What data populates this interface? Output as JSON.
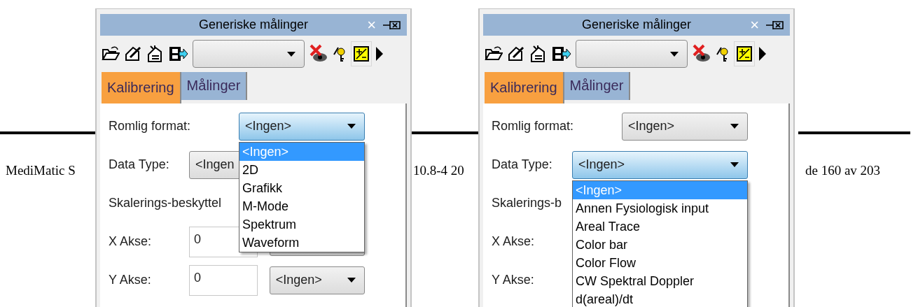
{
  "document": {
    "footer": [
      {
        "kind": "left",
        "text": "MediMatic S"
      },
      {
        "kind": "middle",
        "text": "10.8-4 20"
      },
      {
        "kind": "right",
        "text": "de 160 av 203"
      }
    ]
  },
  "panels": [
    {
      "title": "Generiske målinger",
      "close": "×",
      "tabs": [
        {
          "label": "Kalibrering",
          "selected": true
        },
        {
          "label": "Målinger",
          "selected": false
        }
      ],
      "rows": [
        {
          "kind": "select",
          "label": "Romlig format:",
          "value": "<Ingen>",
          "focused": true,
          "options": [
            {
              "label": "<Ingen>",
              "selected": true
            },
            {
              "label": "2D",
              "selected": false
            },
            {
              "label": "Grafikk",
              "selected": false
            },
            {
              "label": "M-Mode",
              "selected": false
            },
            {
              "label": "Spektrum",
              "selected": false
            },
            {
              "label": "Waveform",
              "selected": false
            }
          ]
        },
        {
          "kind": "wide_select",
          "label": "Data Type:",
          "value": "<Ingen",
          "focused": false
        },
        {
          "kind": "text",
          "label": "Skalerings-beskyttel"
        },
        {
          "kind": "input_select",
          "label": "X Akse:",
          "input": "0"
        },
        {
          "kind": "input_select",
          "label": "Y Akse:",
          "input": "0",
          "value": "<Ingen>"
        }
      ]
    },
    {
      "title": "Generiske målinger",
      "close": "×",
      "tabs": [
        {
          "label": "Kalibrering",
          "selected": true
        },
        {
          "label": "Målinger",
          "selected": false
        }
      ],
      "rows": [
        {
          "kind": "select",
          "label": "Romlig format:",
          "value": "<Ingen>",
          "focused": false
        },
        {
          "kind": "wide_select",
          "label": "Data Type:",
          "value": "<Ingen>",
          "focused": true,
          "options": [
            {
              "label": "<Ingen>",
              "selected": true
            },
            {
              "label": "Annen Fysiologisk input",
              "selected": false
            },
            {
              "label": "Areal Trace",
              "selected": false
            },
            {
              "label": "Color bar",
              "selected": false
            },
            {
              "label": "Color Flow",
              "selected": false
            },
            {
              "label": "CW Spektral Doppler",
              "selected": false
            },
            {
              "label": "d(areal)/dt",
              "selected": false
            }
          ]
        },
        {
          "kind": "text",
          "label": "Skalerings-b"
        },
        {
          "kind": "text",
          "label": "X Akse:"
        },
        {
          "kind": "text",
          "label": "Y Akse:"
        }
      ]
    }
  ]
}
